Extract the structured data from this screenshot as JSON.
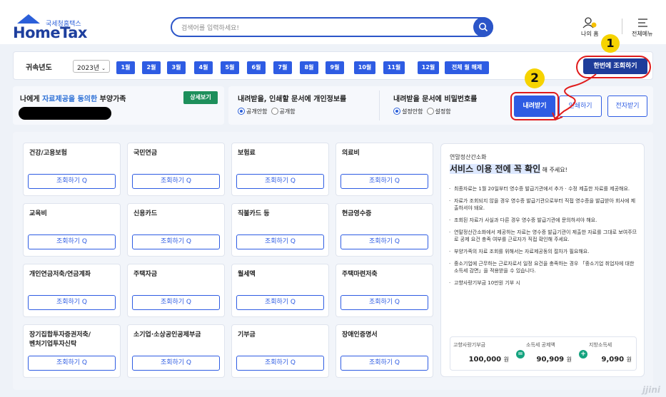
{
  "header": {
    "logo_small": "국세청홈택스",
    "logo_big": "HomeTax",
    "search_placeholder": "검색어를 입력하세요!",
    "my_home_label": "나의 홈",
    "all_menu_label": "전체메뉴"
  },
  "yearbar": {
    "label": "귀속년도",
    "year_value": "2023년",
    "months": [
      "1월",
      "2월",
      "3월",
      "4월",
      "5월",
      "6월",
      "7월",
      "8월",
      "9월",
      "10월",
      "11월",
      "12월"
    ],
    "clear_label": "전체 월 해제",
    "query_all_label": "한번에 조회하기"
  },
  "dependents": {
    "title_prefix": "나에게 ",
    "title_highlight": "자료제공을 동의한",
    "title_suffix": " 부양가족",
    "detail_button": "상세보기"
  },
  "options": {
    "personal_info_title": "내려받을, 인쇄할 문서에 개인정보를",
    "personal_info_options": [
      "공개안함",
      "공개함"
    ],
    "password_title": "내려받을 문서에 비밀번호를",
    "password_options": [
      "설정안함",
      "설정함"
    ],
    "download_button": "내려받기",
    "print_button": "인쇄하기",
    "electronic_button": "전자받기"
  },
  "cards": [
    {
      "title": "건강/고용보험"
    },
    {
      "title": "국민연금"
    },
    {
      "title": "보험료"
    },
    {
      "title": "의료비"
    },
    {
      "title": "교육비"
    },
    {
      "title": "신용카드"
    },
    {
      "title": "직불카드 등"
    },
    {
      "title": "현금영수증"
    },
    {
      "title": "개인연금저축/연금계좌"
    },
    {
      "title": "주택자금"
    },
    {
      "title": "월세액"
    },
    {
      "title": "주택마련저축"
    },
    {
      "title": "장기집합투자증권저축/\n벤처기업투자신탁"
    },
    {
      "title": "소기업·소상공인공제부금"
    },
    {
      "title": "기부금"
    },
    {
      "title": "장애인증명서"
    }
  ],
  "card_button_label": "조회하기 Q",
  "info": {
    "small_title": "연말정산간소화",
    "headline": "서비스 이용 전에 꼭 확인",
    "headline_suffix": " 해 주세요!",
    "notes": [
      "최종자료는 1월 20일부터 영수증 발급기관에서 추가 · 수정 제출한 자료를 제공해요.",
      "자료가 조회되지 않을 경우 영수증 발급기관으로부터 직접 영수증을 발급받아 회사에 제출하셔야 돼요.",
      "조회된 자료가 사실과 다른 경우 영수증 발급기관에 문의하셔야 해요.",
      "연말정산간소화에서 제공하는 자료는 영수증 발급기관이 제출한 자료를 그대로 보여주므로 공제 요건 충족 여부를 근로자가 직접 확인해 주세요.",
      "부양가족의 자료 조회를 위해서는 자료제공동의 절차가 필요해요.",
      "중소기업에 근무하는 근로자로서 일정 요건을 충족하는 경우 「중소기업 취업자에 대한 소득세 감면」을 적용받을 수 있습니다.",
      "고향사랑기부금 10만원 기부 시"
    ],
    "calc": [
      {
        "label": "고향사랑기부금",
        "value": "100,000",
        "unit": "원"
      },
      {
        "label": "소득세 공제액",
        "value": "90,909",
        "unit": "원"
      },
      {
        "label": "지방소득세",
        "value": "9,090",
        "unit": "원"
      }
    ],
    "calc_signs": [
      "=",
      "+"
    ]
  },
  "annotations": {
    "step1": "1",
    "step2": "2"
  },
  "watermark": "jjini"
}
